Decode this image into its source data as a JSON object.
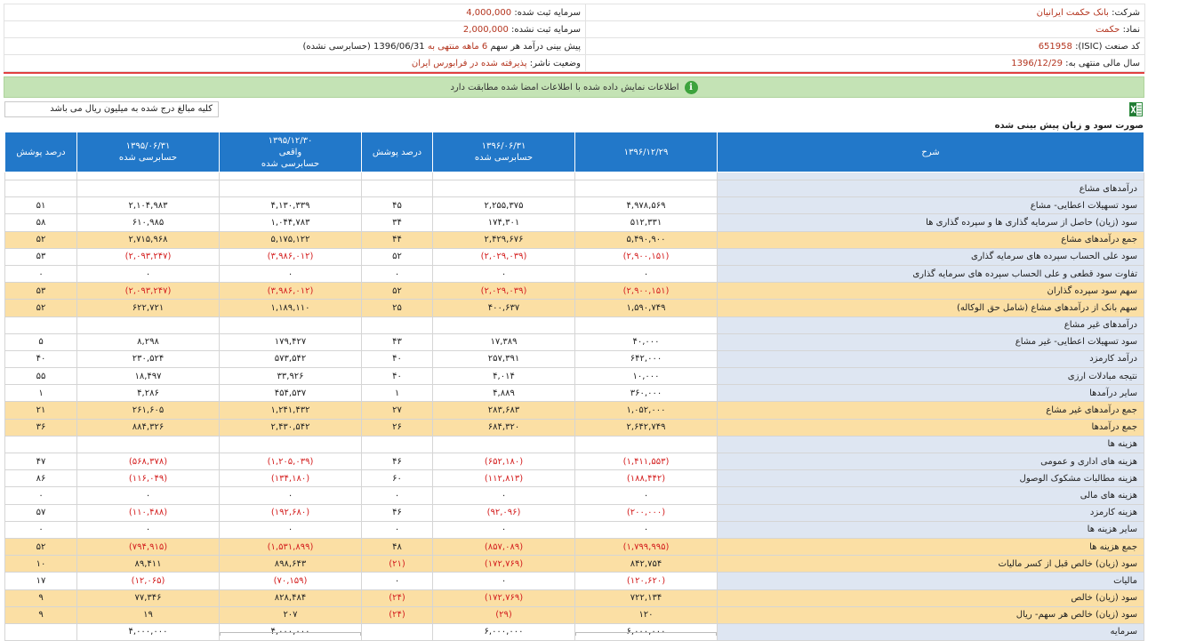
{
  "header": {
    "company_label": "شرکت:",
    "company_value": "بانک حکمت ایرانیان",
    "registered_capital_label": "سرمایه ثبت شده:",
    "registered_capital_value": "4,000,000",
    "symbol_label": "نماد:",
    "symbol_value": "حکمت",
    "unregistered_capital_label": "سرمایه ثبت نشده:",
    "unregistered_capital_value": "2,000,000",
    "isic_label": "کد صنعت (ISIC):",
    "isic_value": "651958",
    "forecast_prefix": "پیش بینی درآمد هر سهم",
    "forecast_period": "6 ماهه منتهی به",
    "forecast_date": "1396/06/31",
    "forecast_suffix": "(حسابرسی نشده)",
    "fiscal_label": "سال مالی منتهی به:",
    "fiscal_value": "1396/12/29",
    "status_label": "وضعیت ناشر:",
    "status_value": "پذیرفته شده در فرابورس ایران"
  },
  "notice": {
    "icon": "info-icon",
    "text": "اطلاعات نمایش داده شده با اطلاعات امضا شده مطابقت دارد"
  },
  "unit_note": "کلیه مبالغ درج شده به میلیون ریال می باشد",
  "export_icon": "excel-icon",
  "table_title": "صورت سود و زیان پیش بینی شده",
  "columns": [
    {
      "line1": "شرح",
      "line2": "",
      "line3": ""
    },
    {
      "line1": "۱۳۹۶/۱۲/۲۹",
      "line2": "",
      "line3": ""
    },
    {
      "line1": "۱۳۹۶/۰۶/۳۱",
      "line2": "حسابرسی شده",
      "line3": ""
    },
    {
      "line1": "درصد پوشش",
      "line2": "",
      "line3": ""
    },
    {
      "line1": "۱۳۹۵/۱۲/۳۰",
      "line2": "واقعی",
      "line3": "حسابرسی شده"
    },
    {
      "line1": "۱۳۹۵/۰۶/۳۱",
      "line2": "حسابرسی شده",
      "line3": ""
    },
    {
      "line1": "درصد پوشش",
      "line2": "",
      "line3": ""
    }
  ],
  "rows": [
    {
      "type": "blank",
      "cells": [
        "",
        "",
        "",
        "",
        "",
        "",
        ""
      ]
    },
    {
      "type": "section",
      "cells": [
        "درآمدهای مشاع",
        "",
        "",
        "",
        "",
        "",
        ""
      ]
    },
    {
      "type": "normal",
      "cells": [
        "سود تسهیلات اعطایی- مشاع",
        "۴,۹۷۸,۵۶۹",
        "۲,۲۵۵,۳۷۵",
        "۴۵",
        "۴,۱۳۰,۳۳۹",
        "۲,۱۰۴,۹۸۳",
        "۵۱"
      ]
    },
    {
      "type": "normal",
      "cells": [
        "سود (زیان) حاصل از سرمایه گذاری ها و سپرده گذاری ها",
        "۵۱۲,۳۳۱",
        "۱۷۴,۳۰۱",
        "۳۴",
        "۱,۰۴۴,۷۸۳",
        "۶۱۰,۹۸۵",
        "۵۸"
      ]
    },
    {
      "type": "total",
      "cells": [
        "جمع درآمدهای مشاع",
        "۵,۴۹۰,۹۰۰",
        "۲,۴۲۹,۶۷۶",
        "۴۴",
        "۵,۱۷۵,۱۲۲",
        "۲,۷۱۵,۹۶۸",
        "۵۲"
      ]
    },
    {
      "type": "normal",
      "cells": [
        "سود علی الحساب سپرده های سرمایه گذاری",
        "(۲,۹۰۰,۱۵۱)",
        "(۲,۰۲۹,۰۳۹)",
        "۵۲",
        "(۳,۹۸۶,۰۱۲)",
        "(۲,۰۹۳,۲۴۷)",
        "۵۳"
      ]
    },
    {
      "type": "normal",
      "cells": [
        "تفاوت سود قطعی و علی الحساب سپرده های سرمایه گذاری",
        "۰",
        "۰",
        "۰",
        "۰",
        "۰",
        "۰"
      ]
    },
    {
      "type": "total",
      "cells": [
        "سهم سود سپرده گذاران",
        "(۲,۹۰۰,۱۵۱)",
        "(۲,۰۲۹,۰۳۹)",
        "۵۲",
        "(۳,۹۸۶,۰۱۲)",
        "(۲,۰۹۳,۲۴۷)",
        "۵۳"
      ]
    },
    {
      "type": "total",
      "cells": [
        "سهم بانک از درآمدهای مشاع (شامل حق الوکاله)",
        "۱,۵۹۰,۷۴۹",
        "۴۰۰,۶۳۷",
        "۲۵",
        "۱,۱۸۹,۱۱۰",
        "۶۲۲,۷۲۱",
        "۵۲"
      ]
    },
    {
      "type": "section",
      "cells": [
        "درآمدهای غیر مشاع",
        "",
        "",
        "",
        "",
        "",
        ""
      ]
    },
    {
      "type": "normal",
      "cells": [
        "سود تسهیلات اعطایی- غیر مشاع",
        "۴۰,۰۰۰",
        "۱۷,۳۸۹",
        "۴۳",
        "۱۷۹,۴۲۷",
        "۸,۲۹۸",
        "۵"
      ]
    },
    {
      "type": "normal",
      "cells": [
        "درآمد کارمزد",
        "۶۴۲,۰۰۰",
        "۲۵۷,۳۹۱",
        "۴۰",
        "۵۷۳,۵۴۲",
        "۲۳۰,۵۲۴",
        "۴۰"
      ]
    },
    {
      "type": "normal",
      "cells": [
        "نتیجه مبادلات ارزی",
        "۱۰,۰۰۰",
        "۴,۰۱۴",
        "۴۰",
        "۳۳,۹۲۶",
        "۱۸,۴۹۷",
        "۵۵"
      ]
    },
    {
      "type": "normal",
      "cells": [
        "سایر درآمدها",
        "۳۶۰,۰۰۰",
        "۴,۸۸۹",
        "۱",
        "۴۵۴,۵۳۷",
        "۴,۲۸۶",
        "۱"
      ]
    },
    {
      "type": "total",
      "cells": [
        "جمع درآمدهای غیر مشاع",
        "۱,۰۵۲,۰۰۰",
        "۲۸۳,۶۸۳",
        "۲۷",
        "۱,۲۴۱,۴۳۲",
        "۲۶۱,۶۰۵",
        "۲۱"
      ]
    },
    {
      "type": "total",
      "cells": [
        "جمع درآمدها",
        "۲,۶۴۲,۷۴۹",
        "۶۸۴,۳۲۰",
        "۲۶",
        "۲,۴۳۰,۵۴۲",
        "۸۸۴,۳۲۶",
        "۳۶"
      ]
    },
    {
      "type": "section",
      "cells": [
        "هزینه ها",
        "",
        "",
        "",
        "",
        "",
        ""
      ]
    },
    {
      "type": "normal",
      "cells": [
        "هزینه های اداری و عمومی",
        "(۱,۴۱۱,۵۵۳)",
        "(۶۵۲,۱۸۰)",
        "۴۶",
        "(۱,۲۰۵,۰۳۹)",
        "(۵۶۸,۳۷۸)",
        "۴۷"
      ]
    },
    {
      "type": "normal",
      "cells": [
        "هزینه مطالبات مشکوک الوصول",
        "(۱۸۸,۴۴۲)",
        "(۱۱۲,۸۱۳)",
        "۶۰",
        "(۱۳۴,۱۸۰)",
        "(۱۱۶,۰۴۹)",
        "۸۶"
      ]
    },
    {
      "type": "normal",
      "cells": [
        "هزینه های مالی",
        "۰",
        "۰",
        "۰",
        "۰",
        "۰",
        "۰"
      ]
    },
    {
      "type": "normal",
      "cells": [
        "هزینه کارمزد",
        "(۲۰۰,۰۰۰)",
        "(۹۲,۰۹۶)",
        "۴۶",
        "(۱۹۲,۶۸۰)",
        "(۱۱۰,۴۸۸)",
        "۵۷"
      ]
    },
    {
      "type": "normal",
      "cells": [
        "سایر هزینه ها",
        "۰",
        "۰",
        "۰",
        "۰",
        "۰",
        "۰"
      ]
    },
    {
      "type": "total",
      "cells": [
        "جمع هزینه ها",
        "(۱,۷۹۹,۹۹۵)",
        "(۸۵۷,۰۸۹)",
        "۴۸",
        "(۱,۵۳۱,۸۹۹)",
        "(۷۹۴,۹۱۵)",
        "۵۲"
      ]
    },
    {
      "type": "total",
      "cells": [
        "سود (زیان) خالص قبل از کسر مالیات",
        "۸۴۲,۷۵۴",
        "(۱۷۲,۷۶۹)",
        "(۲۱)",
        "۸۹۸,۶۴۳",
        "۸۹,۴۱۱",
        "۱۰"
      ]
    },
    {
      "type": "normal",
      "cells": [
        "مالیات",
        "(۱۲۰,۶۲۰)",
        "۰",
        "۰",
        "(۷۰,۱۵۹)",
        "(۱۲,۰۶۵)",
        "۱۷"
      ]
    },
    {
      "type": "total",
      "cells": [
        "سود (زیان) خالص",
        "۷۲۲,۱۳۴",
        "(۱۷۲,۷۶۹)",
        "(۲۴)",
        "۸۲۸,۴۸۴",
        "۷۷,۳۴۶",
        "۹"
      ]
    },
    {
      "type": "total",
      "cells": [
        "سود (زیان) خالص هر سهم- ریال",
        "۱۲۰",
        "(۲۹)",
        "(۲۴)",
        "۲۰۷",
        "۱۹",
        "۹"
      ]
    },
    {
      "type": "normal",
      "cells": [
        "سرمایه",
        "۶,۰۰۰,۰۰۰",
        "۶,۰۰۰,۰۰۰",
        "",
        "۴,۰۰۰,۰۰۰",
        "۴,۰۰۰,۰۰۰",
        ""
      ]
    }
  ]
}
